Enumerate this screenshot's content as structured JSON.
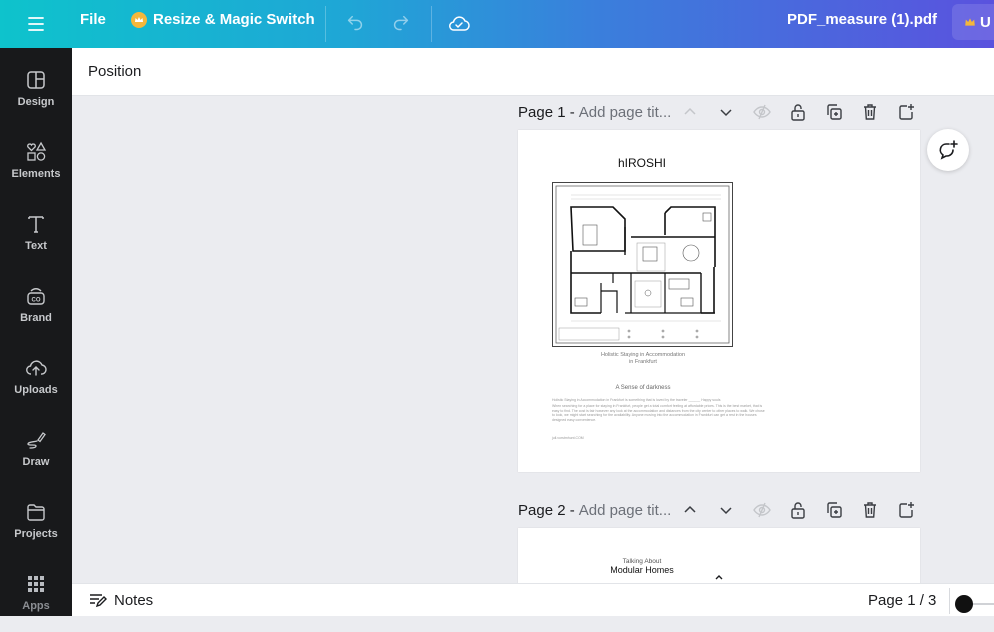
{
  "topbar": {
    "file_label": "File",
    "resize_label": "Resize & Magic Switch",
    "document_name": "PDF_measure (1).pdf",
    "upgrade_label": "U"
  },
  "sidebar": {
    "items": [
      {
        "label": "Design",
        "icon": "design-icon"
      },
      {
        "label": "Elements",
        "icon": "elements-icon"
      },
      {
        "label": "Text",
        "icon": "text-icon"
      },
      {
        "label": "Brand",
        "icon": "brand-icon"
      },
      {
        "label": "Uploads",
        "icon": "uploads-icon"
      },
      {
        "label": "Draw",
        "icon": "draw-icon"
      },
      {
        "label": "Projects",
        "icon": "projects-icon"
      },
      {
        "label": "Apps",
        "icon": "apps-icon"
      }
    ]
  },
  "panel": {
    "title": "Position"
  },
  "pages": [
    {
      "number_label": "Page 1 -",
      "title_placeholder": "Add page tit...",
      "content": {
        "title": "hIROSHI",
        "caption_line1": "Holistic Staying in Accommodation",
        "caption_line2": "in Frankfurt",
        "section_heading": "A Sense of darkness",
        "paragraph_line1": "Holistic Staying in Accommodation in Frankfurt is something that is loved by the traveler ______ Happy souls",
        "paragraph_body": "When searching for a place for staying in Frankfurt, people get a total comfort feeling at affordable prices. This is the best market, that is easy to find. The cost is fair however any look at the accommodation and distances from the city center to other places to walk. We chose to look, we might start searching for the availability. Anyone moving into the accommodation in Frankfurt can get a rest in the houses designed easy convenience.",
        "footer": "jull.vorstmhunt.COM"
      }
    },
    {
      "number_label": "Page 2 -",
      "title_placeholder": "Add page tit...",
      "content": {
        "subtitle": "Talking About",
        "title": "Modular Homes"
      }
    }
  ],
  "bottombar": {
    "notes_label": "Notes",
    "pager_label": "Page 1 / 3"
  }
}
